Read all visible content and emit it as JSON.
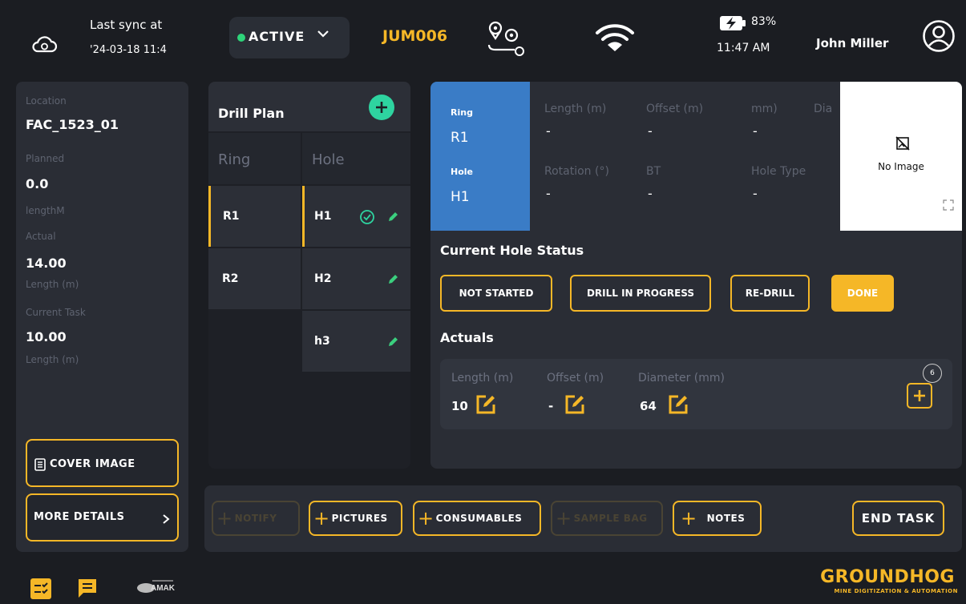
{
  "header": {
    "sync_title": "Last sync at",
    "sync_time": "'24-03-18 11:4",
    "status": "ACTIVE",
    "device_id": "JUM006",
    "battery_pct": "83%",
    "clock": "11:47 AM",
    "username": "John Miller"
  },
  "sidebar": {
    "location_label": "Location",
    "location_value": "FAC_1523_01",
    "planned_label": "Planned",
    "planned_value": "0.0",
    "planned_unit": "lengthM",
    "actual_label": "Actual",
    "actual_value": "14.00",
    "actual_unit": "Length (m)",
    "task_label": "Current Task",
    "task_value": "10.00",
    "task_unit": "Length (m)",
    "cover_image_btn": "COVER IMAGE",
    "more_details_btn": "MORE DETAILS"
  },
  "drill_plan": {
    "title": "Drill Plan",
    "col_ring": "Ring",
    "col_hole": "Hole",
    "rings": [
      "R1",
      "R2"
    ],
    "holes": [
      "H1",
      "H2",
      "h3"
    ]
  },
  "hole_card": {
    "ring_label": "Ring",
    "ring_value": "R1",
    "hole_label": "Hole",
    "hole_value": "H1",
    "length_label": "Length (m)",
    "length_value": "-",
    "offset_label": "Offset (m)",
    "offset_value": "-",
    "mm_label": "mm)",
    "mm_value": "-",
    "dia_label": "Dia",
    "rotation_label": "Rotation (°)",
    "rotation_value": "-",
    "bt_label": "BT",
    "bt_value": "-",
    "hole_type_label": "Hole Type",
    "hole_type_value": "-",
    "no_image": "No Image"
  },
  "status_section": {
    "title": "Current Hole Status",
    "buttons": [
      "NOT STARTED",
      "DRILL IN PROGRESS",
      "RE-DRILL",
      "DONE"
    ],
    "active": "DONE"
  },
  "actuals": {
    "title": "Actuals",
    "length_label": "Length (m)",
    "length_value": "10",
    "offset_label": "Offset (m)",
    "offset_value": "-",
    "diameter_label": "Diameter (mm)",
    "diameter_value": "64",
    "add_count": "6"
  },
  "actions": {
    "notify": "NOTIFY",
    "pictures": "PICTURES",
    "consumables": "CONSUMABLES",
    "sample_bag": "SAMPLE BAG",
    "notes": "NOTES",
    "end_task": "END TASK"
  },
  "footer": {
    "brand": "GROUNDHOG",
    "brand_sub": "MINE DIGITIZATION & AUTOMATION"
  },
  "colors": {
    "accent": "#f5b727",
    "active_green": "#2ed47a",
    "card_blue": "#3a7cc6",
    "add_teal": "#2ed4a0"
  }
}
